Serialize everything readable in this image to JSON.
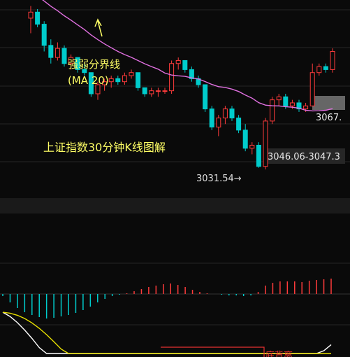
{
  "chart_data": [
    {
      "type": "candlestick",
      "title": "上证指数30分钟K线图解",
      "ma_label_line1": "强弱分界线",
      "ma_label_line2": "(MA 20)",
      "low_label": "3031.54→",
      "gap_label": "3046.06-3047.3",
      "price_tag": "3067.",
      "colors": {
        "up": "#ff3b3b",
        "down": "#00cccc",
        "ma20": "#e070e0",
        "text": "#ffff66"
      },
      "series": [
        {
          "name": "candles",
          "values": [
            [
              3081,
              3085,
              3076,
              3083
            ],
            [
              3083,
              3084,
              3078,
              3079
            ],
            [
              3079,
              3080,
              3070,
              3072
            ],
            [
              3072,
              3074,
              3066,
              3068
            ],
            [
              3068,
              3073,
              3067,
              3071
            ],
            [
              3071,
              3072,
              3065,
              3066
            ],
            [
              3066,
              3069,
              3064,
              3068
            ],
            [
              3068,
              3068,
              3063,
              3064
            ],
            [
              3064,
              3066,
              3062,
              3063
            ],
            [
              3063,
              3063,
              3055,
              3056
            ],
            [
              3056,
              3060,
              3054,
              3059
            ],
            [
              3059,
              3061,
              3057,
              3060
            ],
            [
              3060,
              3062,
              3058,
              3061
            ],
            [
              3061,
              3062,
              3059,
              3060
            ],
            [
              3060,
              3063,
              3059,
              3062
            ],
            [
              3062,
              3064,
              3061,
              3063
            ],
            [
              3063,
              3063,
              3057,
              3058
            ],
            [
              3058,
              3058,
              3055,
              3056
            ],
            [
              3056,
              3058,
              3055,
              3057
            ],
            [
              3057,
              3058,
              3055,
              3057
            ],
            [
              3057,
              3058,
              3056,
              3057
            ],
            [
              3057,
              3067,
              3056,
              3066
            ],
            [
              3066,
              3068,
              3064,
              3067
            ],
            [
              3067,
              3067,
              3063,
              3064
            ],
            [
              3064,
              3065,
              3060,
              3061
            ],
            [
              3061,
              3062,
              3058,
              3059
            ],
            [
              3059,
              3059,
              3050,
              3051
            ],
            [
              3051,
              3052,
              3044,
              3045
            ],
            [
              3045,
              3049,
              3042,
              3048
            ],
            [
              3048,
              3052,
              3046,
              3051
            ],
            [
              3051,
              3052,
              3047,
              3048
            ],
            [
              3048,
              3049,
              3043,
              3044
            ],
            [
              3044,
              3046,
              3037,
              3038
            ],
            [
              3038,
              3040,
              3036,
              3039
            ],
            [
              3039,
              3040,
              3031.54,
              3032
            ],
            [
              3032,
              3048,
              3031,
              3047
            ],
            [
              3047,
              3055,
              3046,
              3054
            ],
            [
              3054,
              3056,
              3052,
              3055
            ],
            [
              3055,
              3056,
              3051,
              3052
            ],
            [
              3052,
              3054,
              3051,
              3053
            ],
            [
              3053,
              3054,
              3050,
              3051
            ],
            [
              3051,
              3053,
              3050,
              3052
            ],
            [
              3052,
              3066,
              3052,
              3063
            ],
            [
              3063,
              3066,
              3062,
              3065
            ],
            [
              3065,
              3066,
              3063,
              3064
            ],
            [
              3064,
              3071,
              3063,
              3070
            ]
          ]
        }
      ]
    },
    {
      "type": "macd",
      "annotation": "底背离",
      "histogram": [
        -0.3,
        -1.2,
        -2.0,
        -2.6,
        -3.0,
        -3.3,
        -3.5,
        -3.4,
        -3.2,
        -3.0,
        -2.7,
        -2.3,
        -1.8,
        -1.2,
        -0.7,
        -0.3,
        -0.1,
        0.1,
        0.4,
        0.7,
        1.0,
        1.2,
        1.4,
        1.5,
        1.3,
        1.0,
        0.6,
        0.3,
        0.1,
        0.0,
        -0.1,
        -0.2,
        -0.2,
        -0.3,
        -0.2,
        0.3,
        1.2,
        1.6,
        1.8,
        1.8,
        1.8,
        1.7,
        1.9,
        2.0,
        2.1,
        2.2
      ]
    }
  ]
}
